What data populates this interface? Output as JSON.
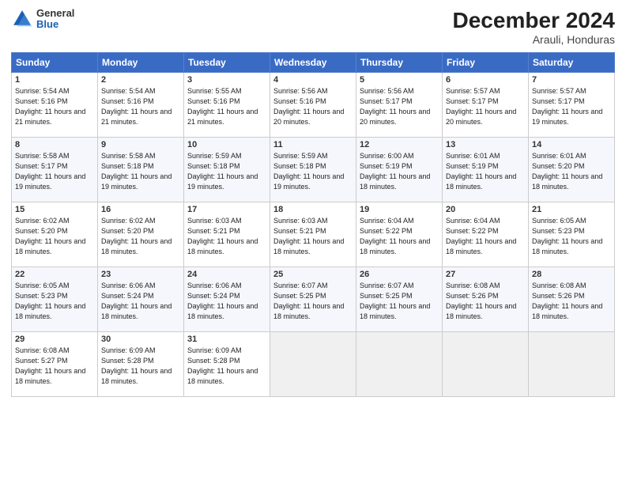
{
  "header": {
    "logo": {
      "general": "General",
      "blue": "Blue"
    },
    "title": "December 2024",
    "location": "Arauli, Honduras"
  },
  "weekdays": [
    "Sunday",
    "Monday",
    "Tuesday",
    "Wednesday",
    "Thursday",
    "Friday",
    "Saturday"
  ],
  "weeks": [
    [
      {
        "day": "1",
        "sunrise": "Sunrise: 5:54 AM",
        "sunset": "Sunset: 5:16 PM",
        "daylight": "Daylight: 11 hours and 21 minutes."
      },
      {
        "day": "2",
        "sunrise": "Sunrise: 5:54 AM",
        "sunset": "Sunset: 5:16 PM",
        "daylight": "Daylight: 11 hours and 21 minutes."
      },
      {
        "day": "3",
        "sunrise": "Sunrise: 5:55 AM",
        "sunset": "Sunset: 5:16 PM",
        "daylight": "Daylight: 11 hours and 21 minutes."
      },
      {
        "day": "4",
        "sunrise": "Sunrise: 5:56 AM",
        "sunset": "Sunset: 5:16 PM",
        "daylight": "Daylight: 11 hours and 20 minutes."
      },
      {
        "day": "5",
        "sunrise": "Sunrise: 5:56 AM",
        "sunset": "Sunset: 5:17 PM",
        "daylight": "Daylight: 11 hours and 20 minutes."
      },
      {
        "day": "6",
        "sunrise": "Sunrise: 5:57 AM",
        "sunset": "Sunset: 5:17 PM",
        "daylight": "Daylight: 11 hours and 20 minutes."
      },
      {
        "day": "7",
        "sunrise": "Sunrise: 5:57 AM",
        "sunset": "Sunset: 5:17 PM",
        "daylight": "Daylight: 11 hours and 19 minutes."
      }
    ],
    [
      {
        "day": "8",
        "sunrise": "Sunrise: 5:58 AM",
        "sunset": "Sunset: 5:17 PM",
        "daylight": "Daylight: 11 hours and 19 minutes."
      },
      {
        "day": "9",
        "sunrise": "Sunrise: 5:58 AM",
        "sunset": "Sunset: 5:18 PM",
        "daylight": "Daylight: 11 hours and 19 minutes."
      },
      {
        "day": "10",
        "sunrise": "Sunrise: 5:59 AM",
        "sunset": "Sunset: 5:18 PM",
        "daylight": "Daylight: 11 hours and 19 minutes."
      },
      {
        "day": "11",
        "sunrise": "Sunrise: 5:59 AM",
        "sunset": "Sunset: 5:18 PM",
        "daylight": "Daylight: 11 hours and 19 minutes."
      },
      {
        "day": "12",
        "sunrise": "Sunrise: 6:00 AM",
        "sunset": "Sunset: 5:19 PM",
        "daylight": "Daylight: 11 hours and 18 minutes."
      },
      {
        "day": "13",
        "sunrise": "Sunrise: 6:01 AM",
        "sunset": "Sunset: 5:19 PM",
        "daylight": "Daylight: 11 hours and 18 minutes."
      },
      {
        "day": "14",
        "sunrise": "Sunrise: 6:01 AM",
        "sunset": "Sunset: 5:20 PM",
        "daylight": "Daylight: 11 hours and 18 minutes."
      }
    ],
    [
      {
        "day": "15",
        "sunrise": "Sunrise: 6:02 AM",
        "sunset": "Sunset: 5:20 PM",
        "daylight": "Daylight: 11 hours and 18 minutes."
      },
      {
        "day": "16",
        "sunrise": "Sunrise: 6:02 AM",
        "sunset": "Sunset: 5:20 PM",
        "daylight": "Daylight: 11 hours and 18 minutes."
      },
      {
        "day": "17",
        "sunrise": "Sunrise: 6:03 AM",
        "sunset": "Sunset: 5:21 PM",
        "daylight": "Daylight: 11 hours and 18 minutes."
      },
      {
        "day": "18",
        "sunrise": "Sunrise: 6:03 AM",
        "sunset": "Sunset: 5:21 PM",
        "daylight": "Daylight: 11 hours and 18 minutes."
      },
      {
        "day": "19",
        "sunrise": "Sunrise: 6:04 AM",
        "sunset": "Sunset: 5:22 PM",
        "daylight": "Daylight: 11 hours and 18 minutes."
      },
      {
        "day": "20",
        "sunrise": "Sunrise: 6:04 AM",
        "sunset": "Sunset: 5:22 PM",
        "daylight": "Daylight: 11 hours and 18 minutes."
      },
      {
        "day": "21",
        "sunrise": "Sunrise: 6:05 AM",
        "sunset": "Sunset: 5:23 PM",
        "daylight": "Daylight: 11 hours and 18 minutes."
      }
    ],
    [
      {
        "day": "22",
        "sunrise": "Sunrise: 6:05 AM",
        "sunset": "Sunset: 5:23 PM",
        "daylight": "Daylight: 11 hours and 18 minutes."
      },
      {
        "day": "23",
        "sunrise": "Sunrise: 6:06 AM",
        "sunset": "Sunset: 5:24 PM",
        "daylight": "Daylight: 11 hours and 18 minutes."
      },
      {
        "day": "24",
        "sunrise": "Sunrise: 6:06 AM",
        "sunset": "Sunset: 5:24 PM",
        "daylight": "Daylight: 11 hours and 18 minutes."
      },
      {
        "day": "25",
        "sunrise": "Sunrise: 6:07 AM",
        "sunset": "Sunset: 5:25 PM",
        "daylight": "Daylight: 11 hours and 18 minutes."
      },
      {
        "day": "26",
        "sunrise": "Sunrise: 6:07 AM",
        "sunset": "Sunset: 5:25 PM",
        "daylight": "Daylight: 11 hours and 18 minutes."
      },
      {
        "day": "27",
        "sunrise": "Sunrise: 6:08 AM",
        "sunset": "Sunset: 5:26 PM",
        "daylight": "Daylight: 11 hours and 18 minutes."
      },
      {
        "day": "28",
        "sunrise": "Sunrise: 6:08 AM",
        "sunset": "Sunset: 5:26 PM",
        "daylight": "Daylight: 11 hours and 18 minutes."
      }
    ],
    [
      {
        "day": "29",
        "sunrise": "Sunrise: 6:08 AM",
        "sunset": "Sunset: 5:27 PM",
        "daylight": "Daylight: 11 hours and 18 minutes."
      },
      {
        "day": "30",
        "sunrise": "Sunrise: 6:09 AM",
        "sunset": "Sunset: 5:28 PM",
        "daylight": "Daylight: 11 hours and 18 minutes."
      },
      {
        "day": "31",
        "sunrise": "Sunrise: 6:09 AM",
        "sunset": "Sunset: 5:28 PM",
        "daylight": "Daylight: 11 hours and 18 minutes."
      },
      null,
      null,
      null,
      null
    ]
  ]
}
